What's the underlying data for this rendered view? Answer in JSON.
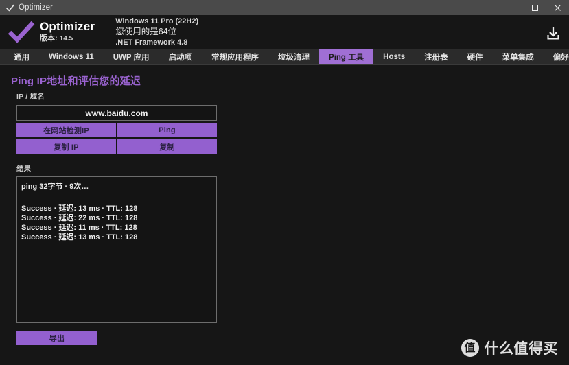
{
  "window": {
    "title": "Optimizer",
    "app_icon": "check-icon",
    "controls": {
      "minimize": "minimize-icon",
      "maximize": "maximize-icon",
      "close": "close-icon"
    }
  },
  "header": {
    "logo": "purple-check-icon",
    "brand_name": "Optimizer",
    "version_label": "版本:",
    "version_number": "14.5",
    "sysinfo": {
      "os": "Windows 11 Pro (22H2)",
      "arch": "您使用的是64位",
      "framework": ".NET Framework 4.8"
    },
    "download_icon": "download-icon"
  },
  "tabs": [
    {
      "label": "通用",
      "active": false
    },
    {
      "label": "Windows 11",
      "active": false
    },
    {
      "label": "UWP 应用",
      "active": false
    },
    {
      "label": "启动项",
      "active": false
    },
    {
      "label": "常规应用程序",
      "active": false
    },
    {
      "label": "垃圾清理",
      "active": false
    },
    {
      "label": "Ping 工具",
      "active": true
    },
    {
      "label": "Hosts",
      "active": false
    },
    {
      "label": "注册表",
      "active": false
    },
    {
      "label": "硬件",
      "active": false
    },
    {
      "label": "菜单集成",
      "active": false
    },
    {
      "label": "偏好选项",
      "active": false
    }
  ],
  "main": {
    "section_title": "Ping IP地址和评估您的延迟",
    "ip_label": "IP / 域名",
    "ip_value": "www.baidu.com",
    "ip_placeholder": "",
    "buttons": {
      "detect_ip": "在网站检测IP",
      "ping": "Ping",
      "copy_ip": "复制 IP",
      "copy": "复制",
      "export": "导出"
    },
    "results_label": "结果",
    "results": {
      "header": "ping 32字节 · 9次…",
      "lines": [
        "Success · 延迟: 13 ms · TTL: 128",
        "Success · 延迟: 22 ms · TTL: 128",
        "Success · 延迟: 11 ms · TTL: 128",
        "Success · 延迟: 13 ms · TTL: 128"
      ]
    }
  },
  "watermark": {
    "logo_char": "值",
    "text": "什么值得买"
  },
  "colors": {
    "accent_purple": "#9360cf",
    "tab_active": "#a06fd4",
    "title_purple": "#9a63d0",
    "titlebar_bg": "#4a4a4a",
    "app_bg": "#161616",
    "tabstrip_bg": "#2b2b2b",
    "field_bg": "#141414",
    "field_border": "#6d6d6d"
  }
}
